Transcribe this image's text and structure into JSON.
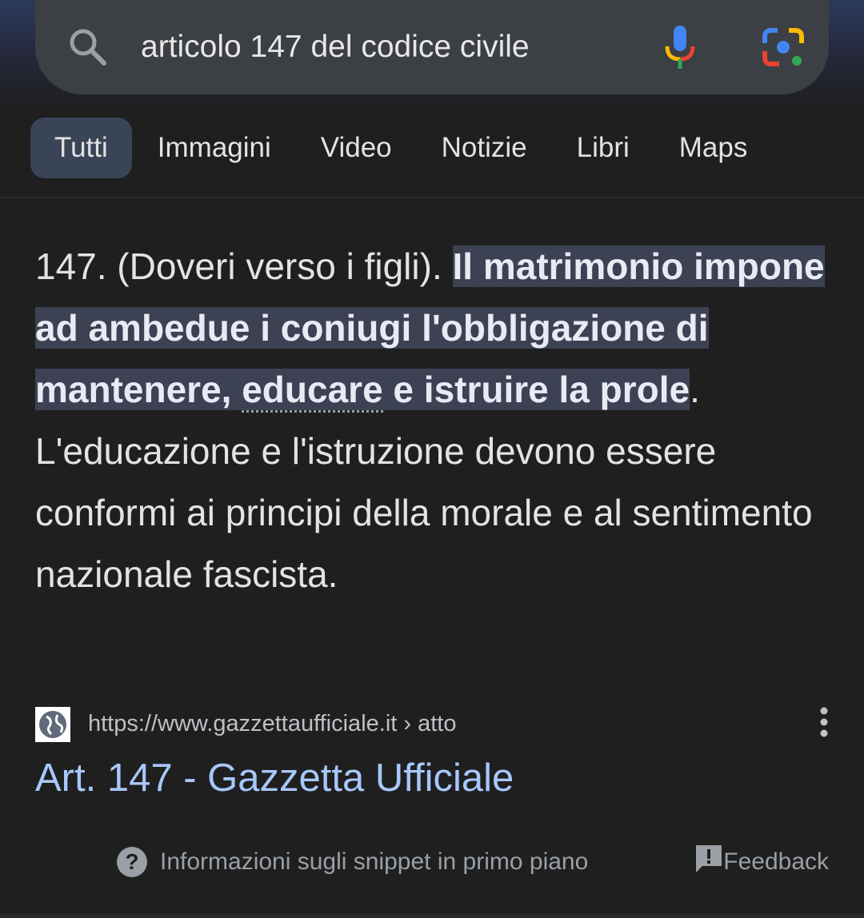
{
  "search": {
    "query": "articolo 147 del codice civile",
    "icons": [
      "search-icon",
      "microphone-icon",
      "google-lens-icon"
    ]
  },
  "tabs": [
    {
      "label": "Tutti",
      "active": true
    },
    {
      "label": "Immagini"
    },
    {
      "label": "Video"
    },
    {
      "label": "Notizie"
    },
    {
      "label": "Libri"
    },
    {
      "label": "Maps"
    }
  ],
  "snippet": {
    "prefix": "147. (Doveri verso i figli). ",
    "highlight_a": "Il matrimonio impone ad ambedue i coniugi l'obbligazione di mantenere, ",
    "highlight_def": "educare",
    "highlight_b": " e istruire la prole",
    "suffix": ". L'educazione e l'istruzione devono essere conformi ai principi della morale e al sentimento nazionale fascista."
  },
  "result": {
    "url": "https://www.gazzettaufficiale.it › atto",
    "title": "Art. 147 - Gazzetta Ufficiale",
    "favicon": "globe-icon",
    "link_color": "#a8c7fa"
  },
  "footer": {
    "info_label": "Informazioni sugli snippet in primo piano",
    "feedback_label": "Feedback"
  },
  "colors": {
    "background": "#1f1f1f",
    "highlight": "#3c4254",
    "active_tab": "#394457"
  }
}
